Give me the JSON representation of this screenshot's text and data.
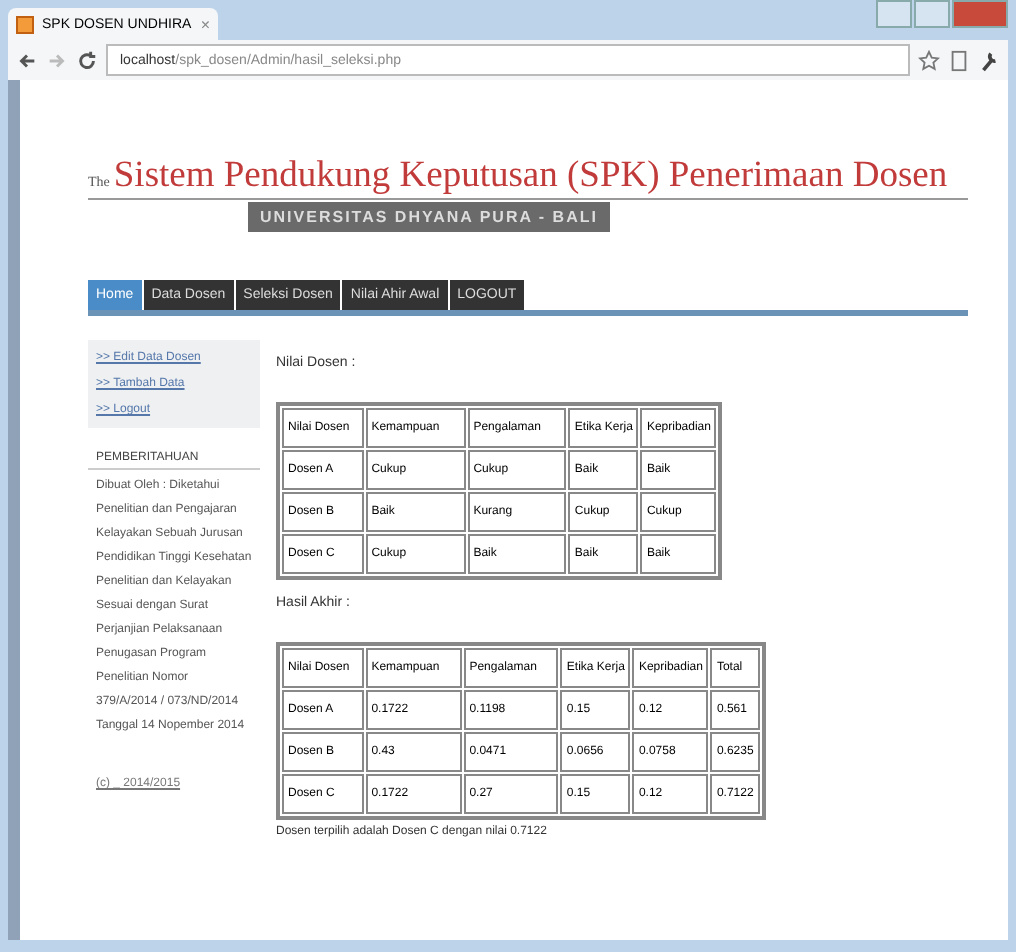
{
  "browser": {
    "tab_title": "SPK DOSEN UNDHIRA",
    "tab_close": "×",
    "url_host": "localhost",
    "url_path": "/spk_dosen/Admin/hasil_seleksi.php"
  },
  "header": {
    "prefix": "The",
    "title": "Sistem Pendukung Keputusan (SPK) Penerimaan Dosen",
    "subtitle": "UNIVERSITAS DHYANA PURA - BALI"
  },
  "nav": [
    {
      "label": "Home",
      "selected": true
    },
    {
      "label": "Data Dosen",
      "selected": false
    },
    {
      "label": "Seleksi Dosen",
      "selected": false
    },
    {
      "label": "Nilai Ahir Awal",
      "selected": false
    },
    {
      "label": "LOGOUT",
      "selected": false
    }
  ],
  "sidebar": {
    "links": [
      ">> Edit Data Dosen",
      ">> Tambah Data",
      ">> Logout"
    ],
    "notice_title": "PEMBERITAHUAN",
    "notice_text": "Dibuat Oleh : Diketahui Penelitian dan Pengajaran Kelayakan Sebuah Jurusan Pendidikan Tinggi Kesehatan Penelitian dan Kelayakan Sesuai dengan Surat Perjanjian Pelaksanaan Penugasan Program Penelitian Nomor 379/A/2014 / 073/ND/2014 Tanggal 14 Nopember 2014",
    "footer_link": "(c) _ 2014/2015"
  },
  "main": {
    "table1_title": "Nilai Dosen :",
    "table1_columns": [
      "Nilai Dosen",
      "Kemampuan",
      "Pengalaman",
      "Etika Kerja",
      "Kepribadian"
    ],
    "table1_rows": [
      [
        "Dosen A",
        "Cukup",
        "Cukup",
        "Baik",
        "Baik"
      ],
      [
        "Dosen B",
        "Baik",
        "Kurang",
        "Cukup",
        "Cukup"
      ],
      [
        "Dosen C",
        "Cukup",
        "Baik",
        "Baik",
        "Baik"
      ]
    ],
    "table2_title": "Hasil Akhir :",
    "table2_columns": [
      "Nilai Dosen",
      "Kemampuan",
      "Pengalaman",
      "Etika Kerja",
      "Kepribadian",
      "Total"
    ],
    "table2_rows": [
      [
        "Dosen A",
        "0.1722",
        "0.1198",
        "0.15",
        "0.12",
        "0.561"
      ],
      [
        "Dosen B",
        "0.43",
        "0.0471",
        "0.0656",
        "0.0758",
        "0.6235"
      ],
      [
        "Dosen C",
        "0.1722",
        "0.27",
        "0.15",
        "0.12",
        "0.7122"
      ]
    ],
    "result": "Dosen terpilih adalah Dosen C dengan nilai 0.7122"
  }
}
